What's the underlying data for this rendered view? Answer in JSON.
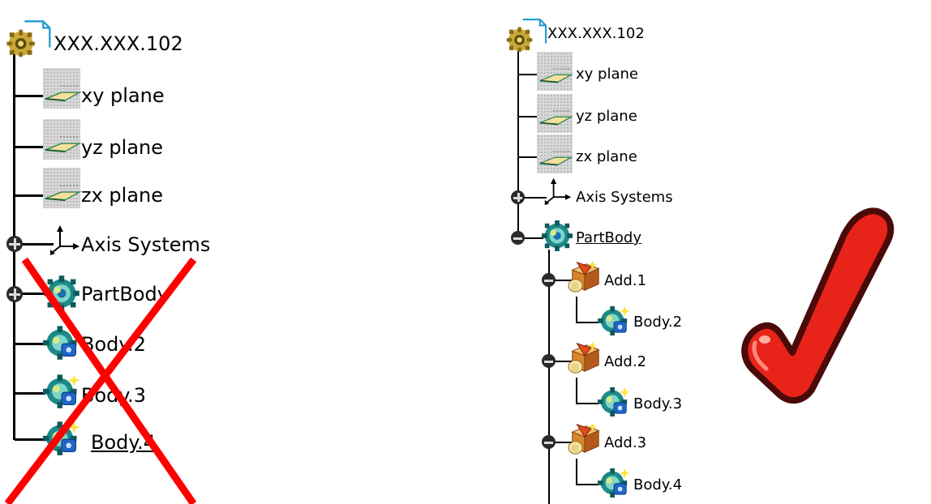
{
  "left_tree": {
    "root": "XXX.XXX.102",
    "items": [
      "xy plane",
      "yz plane",
      "zx plane",
      "Axis Systems",
      "PartBody",
      "Body.2",
      "Body.3",
      "Body.4"
    ]
  },
  "right_tree": {
    "root": "XXX.XXX.102",
    "planes": [
      "xy plane",
      "yz plane",
      "zx plane"
    ],
    "axis": "Axis Systems",
    "partbody": "PartBody",
    "adds": [
      {
        "label": "Add.1",
        "body": "Body.2"
      },
      {
        "label": "Add.2",
        "body": "Body.3"
      },
      {
        "label": "Add.3",
        "body": "Body.4"
      }
    ]
  },
  "colors": {
    "cross": "#ff0000",
    "check_fill": "#e8231a",
    "check_outline": "#4a0a08"
  },
  "icons": [
    "part-document-icon",
    "plane-icon",
    "axis-system-icon",
    "body-icon",
    "add-operation-icon",
    "expand-icon",
    "collapse-icon",
    "red-cross-icon",
    "checkmark-icon"
  ]
}
